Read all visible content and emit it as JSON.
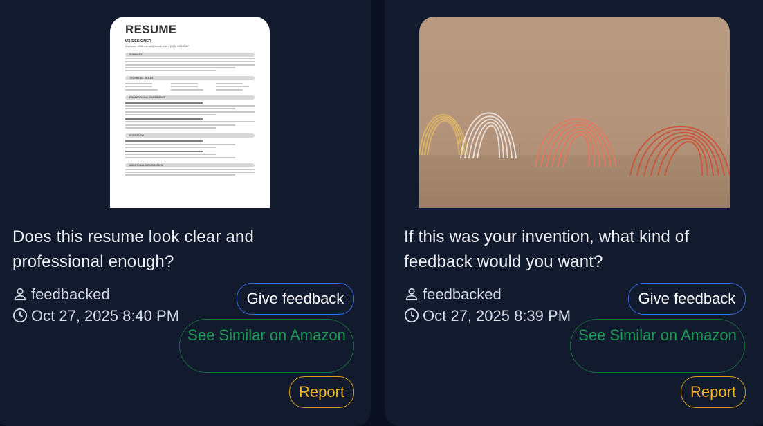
{
  "posts": [
    {
      "question": "Does this resume look clear and professional enough?",
      "author": "feedbacked",
      "timestamp": "Oct 27, 2025 8:40 PM",
      "image_icon": "resume-document-image",
      "resume": {
        "title": "RESUME",
        "role": "UX DESIGNER",
        "contact": "Anytown, USA • email@email.com • (555) 123-4567",
        "sections": [
          "SUMMARY",
          "TECHNICAL SKILLS",
          "PROFESSIONAL EXPERIENCE",
          "EDUCATION",
          "ADDITIONAL INFORMATION"
        ]
      }
    },
    {
      "question": "If this was your invention, what kind of feedback would you want?",
      "author": "feedbacked",
      "timestamp": "Oct 27, 2025 8:39 PM",
      "image_icon": "slinky-photo-image"
    }
  ],
  "actions": {
    "give_feedback": "Give feedback",
    "see_similar": "See Similar on Amazon",
    "report": "Report"
  },
  "colors": {
    "background": "#0b1020",
    "card": "#121a2e",
    "feedback_border": "#3b6de0",
    "amazon": "#1d9a55",
    "report": "#f0b429"
  }
}
